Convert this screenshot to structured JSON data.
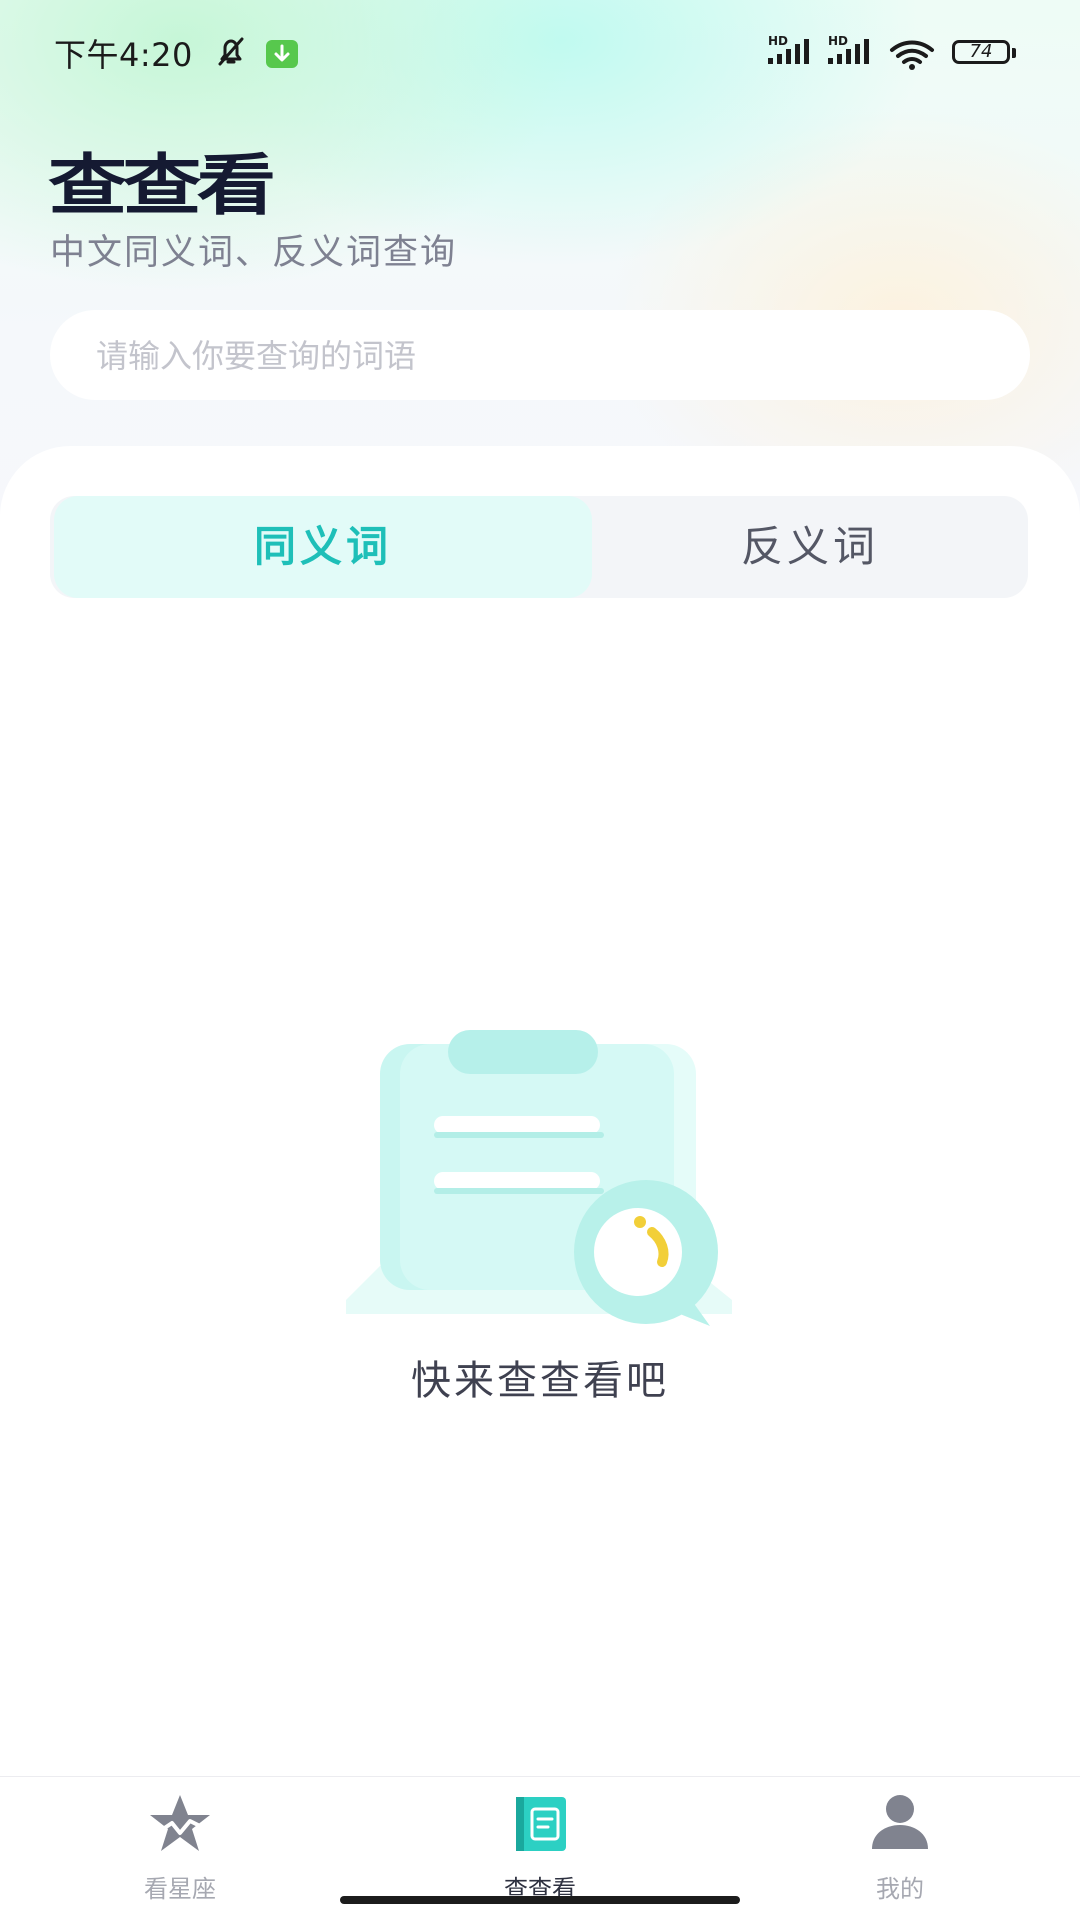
{
  "status_bar": {
    "time": "下午4:20",
    "signal_label": "HD",
    "battery_level": "74",
    "icons": [
      "bell-muted-icon",
      "download-icon",
      "signal-icon",
      "signal-icon",
      "wifi-icon",
      "battery-icon"
    ]
  },
  "header": {
    "title": "查查看",
    "subtitle": "中文同义词、反义词查询"
  },
  "search": {
    "placeholder": "请输入你要查询的词语",
    "value": ""
  },
  "tabs": [
    {
      "label": "同义词",
      "active": true
    },
    {
      "label": "反义词",
      "active": false
    }
  ],
  "empty_state": {
    "icon": "clipboard-search-icon",
    "message": "快来查查看吧"
  },
  "bottom_nav": [
    {
      "label": "看星座",
      "icon": "star-icon",
      "active": false
    },
    {
      "label": "查查看",
      "icon": "book-icon",
      "active": true
    },
    {
      "label": "我的",
      "icon": "user-icon",
      "active": false
    }
  ],
  "colors": {
    "accent": "#1ebfb8",
    "title": "#151a32",
    "subtitle": "#7e8191",
    "nav_inactive": "#a6a8b1",
    "tab_active_bg": "#e2fbf8"
  }
}
